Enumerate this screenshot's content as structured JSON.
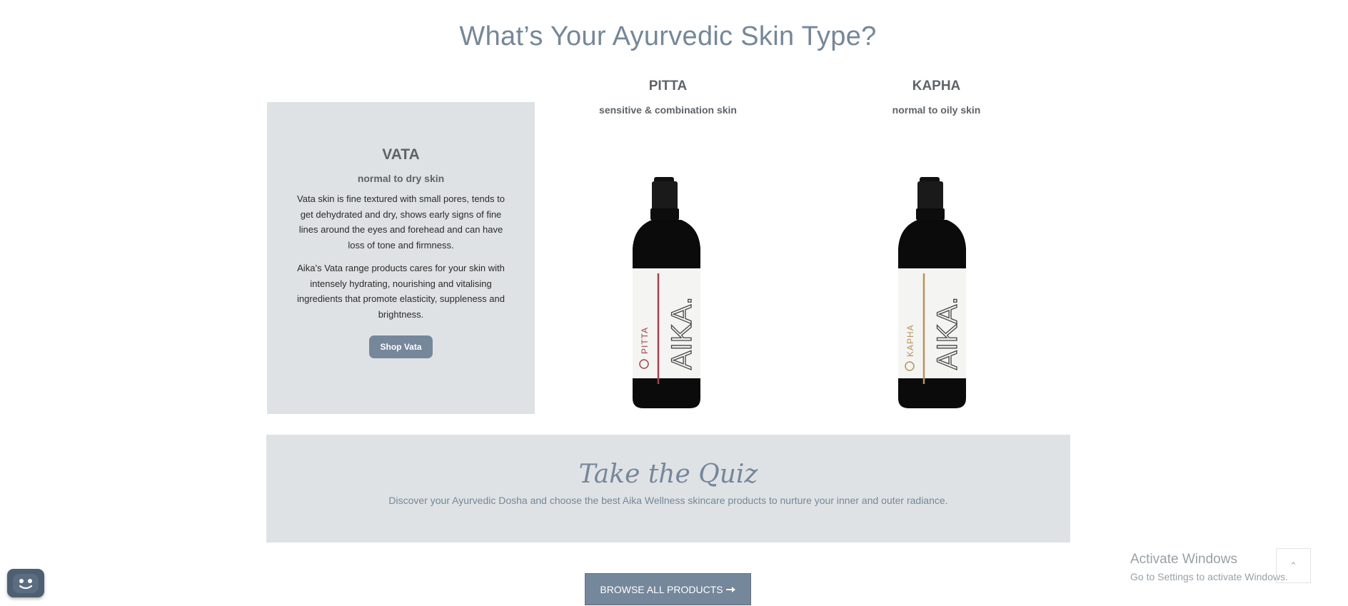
{
  "page": {
    "title": "What’s Your Ayurvedic Skin Type?"
  },
  "cards": {
    "vata": {
      "name": "VATA",
      "subtitle": "normal to dry skin",
      "paragraphs": [
        "Vata skin is fine textured with small pores, tends to get dehydrated and dry, shows early signs of fine lines around the eyes and forehead and can have loss of tone and firmness.",
        "Aika’s Vata range products cares for your skin with intensely hydrating, nourishing and vitalising ingredients that promote elasticity, suppleness and brightness."
      ],
      "button": "Shop Vata"
    },
    "pitta": {
      "name": "PITTA",
      "subtitle": "sensitive & combination skin",
      "label_text": "PITTA",
      "brand": "AIKA.",
      "accent_color": "#a8414b"
    },
    "kapha": {
      "name": "KAPHA",
      "subtitle": "normal to oily skin",
      "label_text": "KAPHA",
      "brand": "AIKA.",
      "accent_color": "#b8925a"
    }
  },
  "quiz": {
    "title": "Take the Quiz",
    "text": "Discover your Ayurvedic Dosha and choose the best Aika Wellness skincare products to nurture your inner and outer radiance."
  },
  "browse": {
    "label": "BROWSE ALL PRODUCTS",
    "icon": "arrow-right-icon"
  },
  "watermark": {
    "title": "Activate Windows",
    "subtitle": "Go to Settings to activate Windows."
  },
  "scroll_top": {
    "icon": "chevron-up-icon",
    "glyph": "⌃"
  },
  "chat": {
    "icon": "chat-bot-icon"
  },
  "colors": {
    "accent": "#75879a",
    "panel": "#dfe2e4"
  }
}
